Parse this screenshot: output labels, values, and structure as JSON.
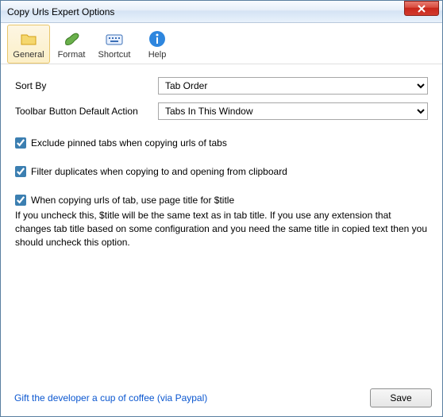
{
  "window": {
    "title": "Copy Urls Expert Options"
  },
  "toolbar": {
    "items": [
      {
        "label": "General",
        "icon": "folder-icon",
        "active": true
      },
      {
        "label": "Format",
        "icon": "paint-icon",
        "active": false
      },
      {
        "label": "Shortcut",
        "icon": "keyboard-icon",
        "active": false
      },
      {
        "label": "Help",
        "icon": "info-icon",
        "active": false
      }
    ]
  },
  "form": {
    "sort_by_label": "Sort By",
    "sort_by_value": "Tab Order",
    "toolbar_action_label": "Toolbar Button Default Action",
    "toolbar_action_value": "Tabs In This Window",
    "exclude_pinned_label": "Exclude pinned tabs when copying urls of tabs",
    "exclude_pinned_checked": true,
    "filter_dup_label": "Filter duplicates when copying to and opening from clipboard",
    "filter_dup_checked": true,
    "use_title_label": "When copying urls of tab, use page title for $title",
    "use_title_checked": true,
    "use_title_help": "If you uncheck this, $title will be the same text as in tab title. If you use any extension that changes tab title based on some configuration and you need the same title in copied text then you should uncheck this option."
  },
  "footer": {
    "gift_text": "Gift the developer a cup of coffee (via Paypal)",
    "save_label": "Save"
  }
}
